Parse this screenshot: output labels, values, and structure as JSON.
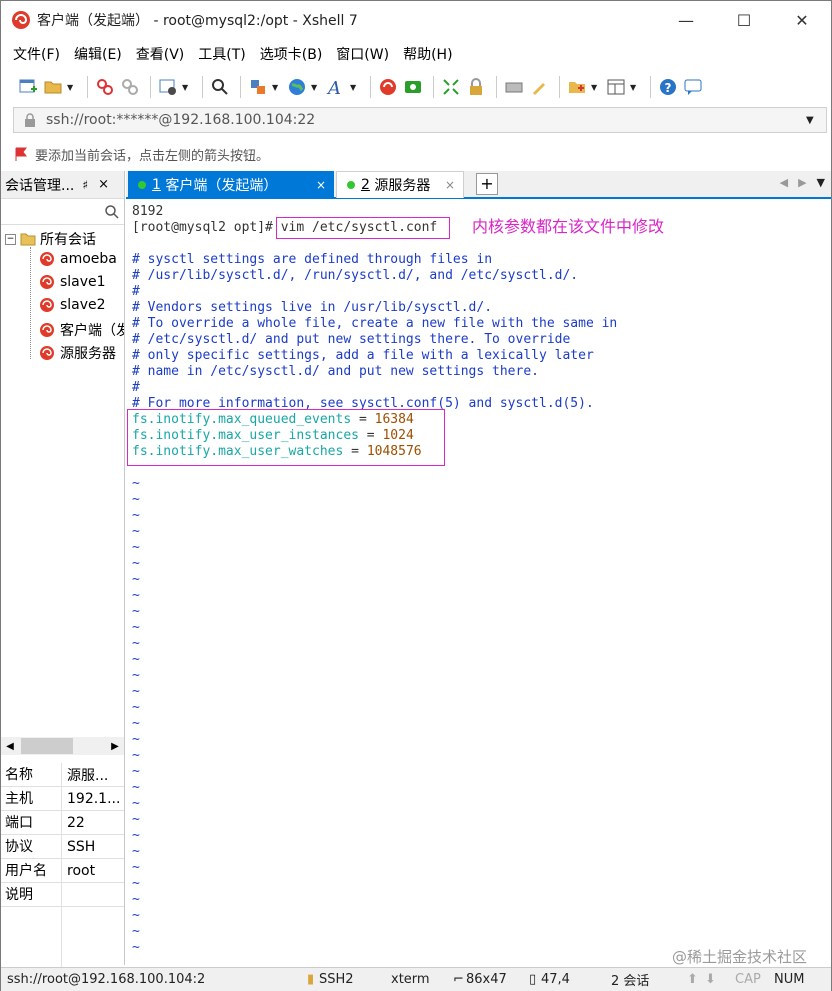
{
  "window": {
    "title": "客户端（发起端） - root@mysql2:/opt - Xshell 7",
    "minimize": "—",
    "maximize": "☐",
    "close": "✕"
  },
  "menu": [
    "文件(F)",
    "编辑(E)",
    "查看(V)",
    "工具(T)",
    "选项卡(B)",
    "窗口(W)",
    "帮助(H)"
  ],
  "address": {
    "value": "ssh://root:******@192.168.100.104:22"
  },
  "hint": {
    "text": "要添加当前会话，点击左侧的箭头按钮。"
  },
  "session_panel": {
    "title": "会话管理...",
    "pin": "♯",
    "close": "×",
    "root": "所有会话",
    "items": [
      "amoeba",
      "slave1",
      "slave2",
      "客户端（发",
      "源服务器"
    ],
    "props": [
      {
        "k": "名称",
        "v": "源服..."
      },
      {
        "k": "主机",
        "v": "192.1..."
      },
      {
        "k": "端口",
        "v": "22"
      },
      {
        "k": "协议",
        "v": "SSH"
      },
      {
        "k": "用户名",
        "v": "root"
      },
      {
        "k": "说明",
        "v": ""
      }
    ]
  },
  "tabs": [
    {
      "num": "1",
      "label": "客户端（发起端）",
      "close": "×"
    },
    {
      "num": "2",
      "label": "源服务器",
      "close": "×"
    }
  ],
  "tab_add": "+",
  "terminal": {
    "line_top": "8192",
    "prompt": "[root@mysql2 opt]#",
    "command": "vim /etc/sysctl.conf",
    "annotation": "内核参数都在该文件中修改",
    "comments": [
      "# sysctl settings are defined through files in",
      "# /usr/lib/sysctl.d/, /run/sysctl.d/, and /etc/sysctl.d/.",
      "#",
      "# Vendors settings live in /usr/lib/sysctl.d/.",
      "# To override a whole file, create a new file with the same in",
      "# /etc/sysctl.d/ and put new settings there. To override",
      "# only specific settings, add a file with a lexically later",
      "# name in /etc/sysctl.d/ and put new settings there.",
      "#",
      "# For more information, see sysctl.conf(5) and sysctl.d(5)."
    ],
    "settings": [
      {
        "key": "fs.inotify.max_queued_events",
        "value": "16384"
      },
      {
        "key": "fs.inotify.max_user_instances",
        "value": "1024"
      },
      {
        "key": "fs.inotify.max_user_watches",
        "value": "1048576"
      }
    ],
    "tilde": "~",
    "watermark": "@稀土掘金技术社区"
  },
  "statusbar": {
    "connection": "ssh://root@192.168.100.104:2",
    "protocol": "SSH2",
    "term": "xterm",
    "size": "86x47",
    "pos": "47,4",
    "sessions": "2 会话",
    "cap": "CAP",
    "num": "NUM"
  },
  "colors": {
    "accent": "#0078d7",
    "annotation": "#d826c8",
    "comment": "#1c3cc8",
    "setting": "#19a6a6",
    "number": "#a04e00"
  }
}
